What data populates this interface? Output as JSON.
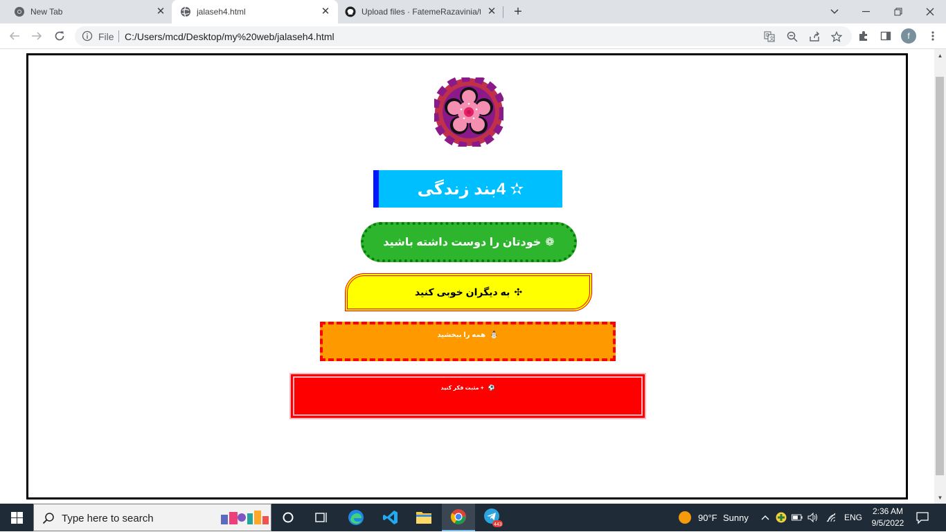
{
  "browser": {
    "tabs": [
      {
        "label": "New Tab",
        "icon": "chrome-icon",
        "active": false
      },
      {
        "label": "jalaseh4.html",
        "icon": "globe-icon",
        "active": true
      },
      {
        "label": "Upload files · FatemeRazavinia/ta",
        "icon": "github-icon",
        "active": false
      }
    ],
    "address": {
      "scheme_label": "File",
      "url": "C:/Users/mcd/Desktop/my%20web/jalaseh4.html"
    },
    "profile_initial": "f"
  },
  "page": {
    "items": [
      {
        "glyph": "✫",
        "text": "4بند زندگی"
      },
      {
        "glyph": "❁",
        "text": "خودتان را دوست داشته باشید"
      },
      {
        "glyph": "✣",
        "text": "به دیگران خوبی کنید"
      },
      {
        "glyph": "⛄",
        "text": "همه را ببخشید"
      },
      {
        "glyph": "⚽",
        "text": "+ مثبت فکر کنید"
      }
    ],
    "colors": {
      "item1_bg": "#00bfff",
      "item1_border": "#0019ff",
      "item2_bg": "#2db52d",
      "item3_bg": "#ffff00",
      "item4_bg": "#ff9900",
      "item5_bg": "#ff0000",
      "logo_ring": "#9b1a7a",
      "logo_flower": "#f48fb1"
    }
  },
  "taskbar": {
    "search_placeholder": "Type here to search",
    "weather_temp": "90°F",
    "weather_desc": "Sunny",
    "language": "ENG",
    "time": "2:36 AM",
    "date": "9/5/2022",
    "telegram_badge": "443"
  }
}
